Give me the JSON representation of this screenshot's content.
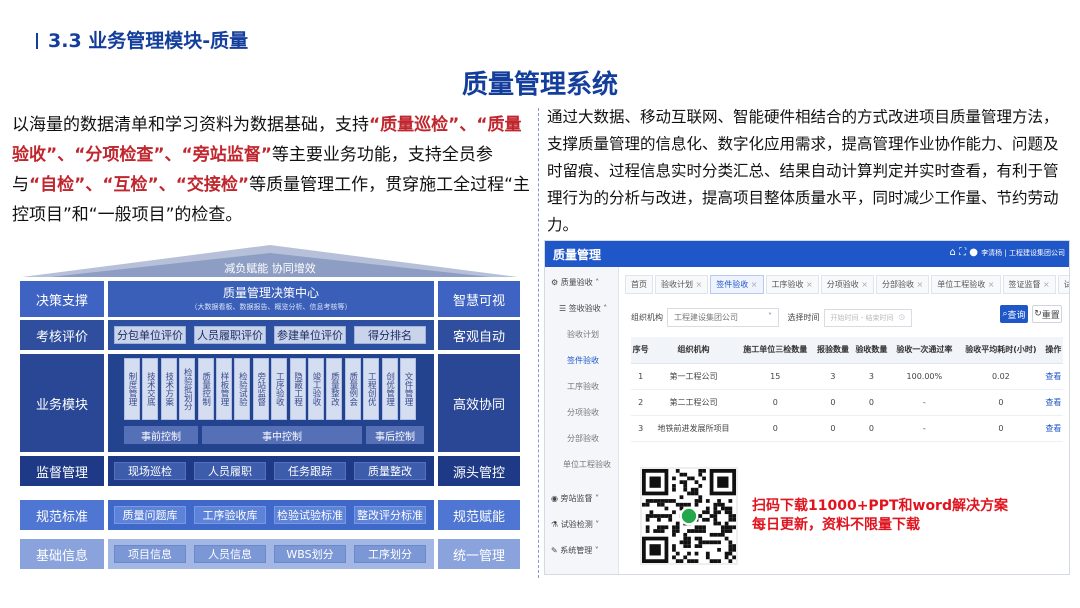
{
  "section_heading": "3.3  业务管理模块-质量",
  "page_title": "质量管理系统",
  "left_paragraph": {
    "p1": "以海量的数据清单和学习资料为数据基础，支持",
    "h1": "“质量巡检”",
    "s1": "、",
    "h2": "“质量验收”",
    "s2": "、",
    "h3": "“分项检查”",
    "s3": "、",
    "h4": "“旁站监督”",
    "p2": "等主要业务功能，支持全员参与",
    "h5": "“自检”",
    "s4": "、",
    "h6": "“互检”",
    "s5": "、",
    "h7": "“交接检”",
    "p3": "等质量管理工作，贯穿施工全过程“主控项目”和“一般项目”的检查。"
  },
  "right_paragraph": "通过大数据、移动互联网、智能硬件相结合的方式改进项目质量管理方法，支撑质量管理的信息化、数字化应用需求，提高管理作业协作能力、问题及时留痕、过程信息实时分类汇总、结果自动计算判定并实时查看，有利于管理行为的分析与改进，提高项目整体质量水平，同时减少工作量、节约劳动力。",
  "architecture": {
    "roof_label": "减负赋能  协同增效",
    "rows": [
      {
        "left": "决策支撑",
        "right": "智慧可视",
        "center_title": "质量管理决策中心",
        "center_sub": "（大数据看板、数据报告、概览分析、信息考核等）"
      },
      {
        "left": "考核评价",
        "right": "客观自动",
        "chips": [
          "分包单位评价",
          "人员履职评价",
          "参建单位评价",
          "得分排名"
        ]
      },
      {
        "left": "业务模块",
        "right": "高效协同",
        "vchips": [
          "制度管理",
          "技术交底",
          "技术方案",
          "检验批划分",
          "质量控制",
          "样板管理",
          "检验试验",
          "旁站监督",
          "工序验收",
          "隐蔽工程",
          "竣工验收",
          "质量整改",
          "质量例会",
          "工程创优",
          "创优管理",
          "文件管理"
        ],
        "controls": [
          "事前控制",
          "事中控制",
          "事后控制"
        ]
      },
      {
        "left": "监督管理",
        "right": "源头管控",
        "chips": [
          "现场巡检",
          "人员履职",
          "任务跟踪",
          "质量整改"
        ]
      },
      {
        "left": "规范标准",
        "right": "规范赋能",
        "chips": [
          "质量问题库",
          "工序验收库",
          "检验试验标准",
          "整改评分标准"
        ]
      },
      {
        "left": "基础信息",
        "right": "统一管理",
        "chips": [
          "项目信息",
          "人员信息",
          "WBS划分",
          "工序划分"
        ]
      }
    ]
  },
  "app": {
    "title": "质量管理",
    "user": "李清杨 | 工程建设集团公司",
    "sidebar": {
      "main": "质量验收",
      "group": "签收验收",
      "subs": [
        "验收计划",
        "签件验收",
        "工序验收",
        "分项验收",
        "分部验收",
        "单位工程验收"
      ],
      "others": [
        "旁站监督",
        "试验检测",
        "系统管理"
      ]
    },
    "tabs": [
      "首页",
      "验收计划",
      "签件验收",
      "工序验收",
      "分项验收",
      "分部验收",
      "单位工程验收",
      "签证监督",
      "试验检测"
    ],
    "filter": {
      "org_label": "组织机构",
      "org_value": "工程建设集团公司",
      "time_label": "选择时间",
      "time_placeholder": "开始时间 - 结束时间"
    },
    "query_button": "查询",
    "reset_button": "重置",
    "columns": [
      "序号",
      "组织机构",
      "施工单位三检数量",
      "报验数量",
      "验收数量",
      "验收一次通过率",
      "验收平均耗时(小时)",
      "操作"
    ],
    "rows": [
      [
        "1",
        "第一工程公司",
        "15",
        "3",
        "3",
        "100.00%",
        "0.02",
        "查看"
      ],
      [
        "2",
        "第二工程公司",
        "0",
        "0",
        "0",
        "-",
        "0",
        "查看"
      ],
      [
        "3",
        "地铁前进发展所项目",
        "0",
        "0",
        "0",
        "-",
        "0",
        "查看"
      ]
    ]
  },
  "promo": {
    "line1": "扫码下载11000+PPT和word解决方案",
    "line2": "每日更新，资料不限量下载"
  },
  "colors": {
    "brand": "#143e9b",
    "highlight": "#c0262d",
    "promo": "#e0141e",
    "app_header": "#1f57c8"
  }
}
